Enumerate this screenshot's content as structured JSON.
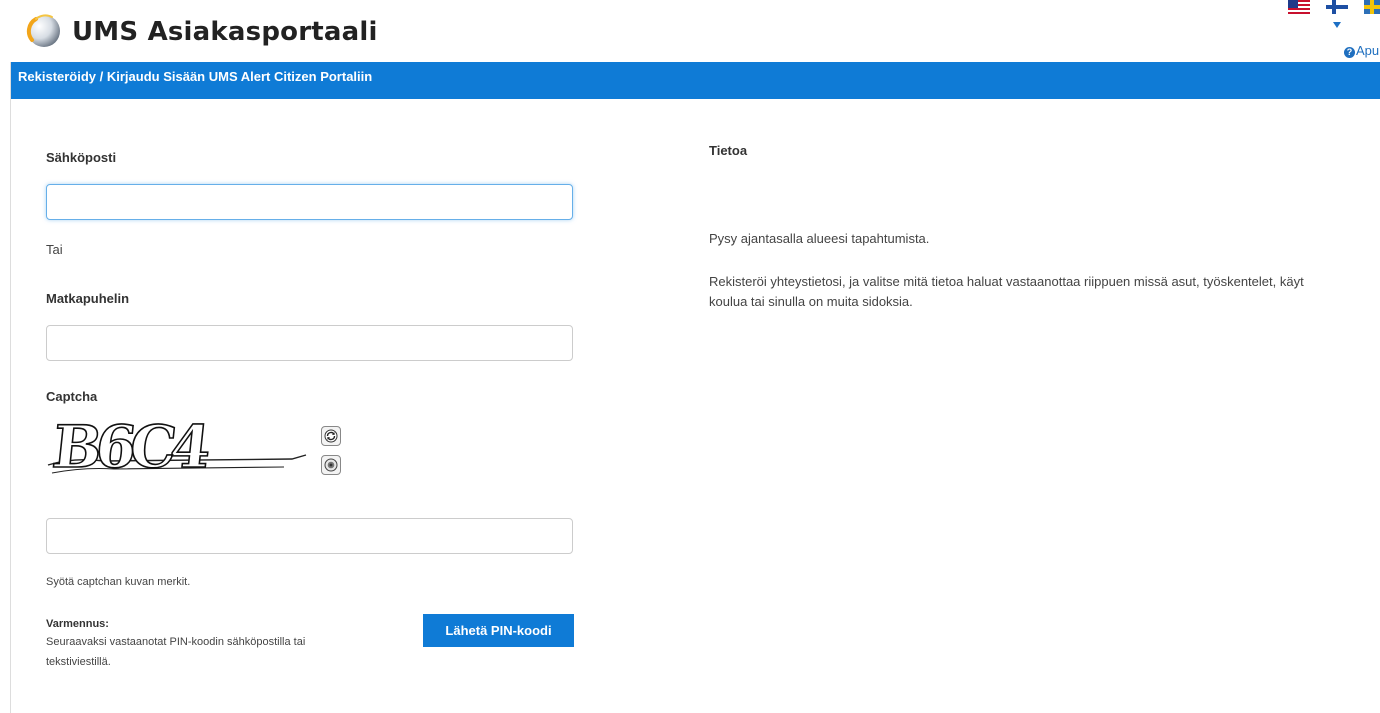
{
  "header": {
    "app_title": "UMS Asiakasportaali",
    "help_label": "Apu",
    "languages": [
      "en-us-flag-icon",
      "fi-flag-icon",
      "sv-flag-icon"
    ]
  },
  "panel": {
    "title": "Rekisteröidy / Kirjaudu Sisään UMS Alert Citizen Portaliin",
    "accent_color": "#0f7bd6"
  },
  "form": {
    "email_label": "Sähköposti",
    "email_value": "",
    "or_label": "Tai",
    "mobile_label": "Matkapuhelin",
    "mobile_value": "",
    "captcha_label": "Captcha",
    "captcha_text": "B6C4",
    "captcha_value": "",
    "captcha_hint": "Syötä captchan kuvan merkit.",
    "verification_title": "Varmennus:",
    "verification_text": "Seuraavaksi vastaanotat PIN-koodin sähköpostilla tai tekstiviestillä.",
    "send_pin_label": "Lähetä PIN-koodi"
  },
  "info": {
    "title": "Tietoa",
    "paragraph1": "Pysy ajantasalla alueesi tapahtumista.",
    "paragraph2": "Rekisteröi yhteystietosi, ja valitse mitä tietoa haluat vastaanottaa riippuen missä asut, työskentelet, käyt koulua tai sinulla on muita sidoksia."
  }
}
